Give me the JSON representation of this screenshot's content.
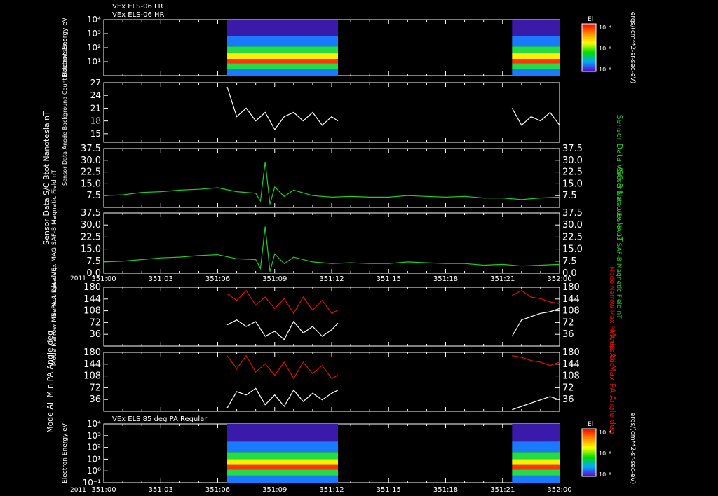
{
  "header": {
    "line1": "VEx ELS-06 LR",
    "line2": "VEx ELS-06 HR",
    "panel7_title": "VEx ELS 85 deg PA Regular"
  },
  "colors": {
    "background": "#000000",
    "axis": "#ffffff",
    "mag_trace": "#22cc22",
    "max_pa": "#dd1111",
    "min_pa": "#ffffff",
    "right_label_green": "#22cc22",
    "right_label_red": "#dd1111"
  },
  "colorbar": {
    "title": "El",
    "ticks": [
      "10⁻⁴",
      "10⁻⁶",
      "10⁻⁸"
    ],
    "units": "ergs/(cm**2-sr-sec-eV)"
  },
  "time_axis": {
    "year": "2011",
    "ticks": [
      "351:00",
      "351:03",
      "351:06",
      "351:09",
      "351:12",
      "351:15",
      "351:18",
      "351:21",
      "352:00"
    ]
  },
  "chart_data": [
    {
      "type": "heatmap",
      "title": "VEx ELS-06 HR",
      "ylabel": "Electron Energy eV",
      "yscale": "log",
      "ylim": [
        1,
        10000
      ],
      "yticks": [
        "10⁴",
        "10³",
        "10²",
        "10¹"
      ],
      "data_intervals": [
        [
          "351:06:30",
          "351:12:20"
        ],
        [
          "351:21:30",
          "352:00"
        ]
      ],
      "colorbar_label": "El"
    },
    {
      "type": "line",
      "ylabel": "Sensor Data Anode Background Count Rate cnts/sec",
      "ylim": [
        13,
        27
      ],
      "yticks": [
        27,
        24,
        21,
        18,
        15
      ],
      "series": [
        {
          "x": [
            "351:06:30",
            "351:07",
            "351:07:30",
            "351:08",
            "351:08:30",
            "351:09",
            "351:09:30",
            "351:10",
            "351:10:30",
            "351:11",
            "351:11:30",
            "351:12",
            "351:12:20"
          ],
          "values": [
            26,
            19,
            21,
            18,
            20,
            16,
            19,
            20,
            18,
            20,
            17,
            19,
            18
          ]
        },
        {
          "x": [
            "351:21:30",
            "351:22",
            "351:22:30",
            "351:23",
            "351:23:30",
            "352:00"
          ],
          "values": [
            21,
            17,
            19,
            18,
            20,
            17
          ]
        }
      ]
    },
    {
      "type": "line",
      "ylabel": "Sensor Data S/C Btot Nanotesla nT",
      "ylabel_right": "Sensor Data VSO B Nanotesla nT",
      "ylim": [
        0,
        37.5
      ],
      "yticks": [
        "37.5",
        "30.0",
        "22.5",
        "15.0",
        "7.5"
      ],
      "series": [
        {
          "x": [
            "351:00",
            "351:01",
            "351:02",
            "351:03",
            "351:04",
            "351:05",
            "351:06",
            "351:07",
            "351:08",
            "351:08:15",
            "351:08:30",
            "351:08:45",
            "351:09",
            "351:09:15",
            "351:09:30",
            "351:10",
            "351:11",
            "351:12",
            "351:13",
            "351:14",
            "351:15",
            "351:16",
            "351:17",
            "351:18",
            "351:19",
            "351:20",
            "351:21",
            "351:22",
            "351:23",
            "352:00"
          ],
          "values": [
            7.5,
            8,
            9.5,
            10,
            11,
            11.5,
            12.5,
            10,
            9,
            4,
            29,
            2,
            13,
            10,
            7,
            11,
            7.5,
            6.5,
            7,
            6.5,
            6.5,
            7.5,
            7,
            6.5,
            7,
            6,
            6,
            5,
            6,
            6.5
          ]
        }
      ]
    },
    {
      "type": "line",
      "ylabel": "Sensor Data VEx MAG SAF-B Magnetic Field nT",
      "ylabel_right": "Sensor Data VEx MAG3 SAF-B Magnetic Field nT",
      "ylim": [
        0,
        37.5
      ],
      "yticks": [
        "37.5",
        "30.0",
        "22.5",
        "15.0",
        "7.5",
        "0.0"
      ],
      "series": [
        {
          "x": [
            "351:00",
            "351:01",
            "351:02",
            "351:03",
            "351:04",
            "351:05",
            "351:06",
            "351:07",
            "351:08",
            "351:08:15",
            "351:08:30",
            "351:08:45",
            "351:09",
            "351:09:15",
            "351:09:30",
            "351:10",
            "351:11",
            "351:12",
            "351:13",
            "351:14",
            "351:15",
            "351:16",
            "351:17",
            "351:18",
            "351:19",
            "351:20",
            "351:21",
            "351:22",
            "351:23",
            "352:00"
          ],
          "values": [
            7,
            7.5,
            8.5,
            9.5,
            10,
            11,
            11.5,
            9,
            8.5,
            3,
            29,
            1,
            12,
            9,
            6,
            10,
            7,
            6,
            6.5,
            6,
            6,
            7,
            6.5,
            6,
            6,
            5,
            5.5,
            4.5,
            5,
            5.5
          ]
        }
      ]
    },
    {
      "type": "line",
      "ylabel": "Mode Narrow Min PA Angle deg",
      "ylabel_right": "Mode Narrow Max PA Angle deg",
      "ylim": [
        0,
        180
      ],
      "yticks": [
        180,
        144,
        108,
        72,
        36
      ],
      "series": [
        {
          "name": "max",
          "x": [
            "351:06:30",
            "351:07",
            "351:07:30",
            "351:08",
            "351:08:30",
            "351:09",
            "351:09:30",
            "351:10",
            "351:10:30",
            "351:11",
            "351:11:30",
            "351:12",
            "351:12:20"
          ],
          "values": [
            160,
            140,
            170,
            125,
            150,
            115,
            145,
            100,
            150,
            110,
            140,
            100,
            110
          ]
        },
        {
          "name": "min",
          "x": [
            "351:06:30",
            "351:07",
            "351:07:30",
            "351:08",
            "351:08:30",
            "351:09",
            "351:09:30",
            "351:10",
            "351:10:30",
            "351:11",
            "351:11:30",
            "351:12",
            "351:12:20"
          ],
          "values": [
            65,
            80,
            60,
            75,
            30,
            45,
            20,
            75,
            40,
            60,
            30,
            50,
            70
          ]
        },
        {
          "name": "max",
          "x": [
            "351:21:30",
            "351:22",
            "351:22:30",
            "351:23",
            "351:23:30",
            "352:00"
          ],
          "values": [
            155,
            170,
            150,
            145,
            135,
            130
          ]
        },
        {
          "name": "min",
          "x": [
            "351:21:30",
            "351:22",
            "351:22:30",
            "351:23",
            "351:23:30",
            "352:00"
          ],
          "values": [
            30,
            80,
            90,
            100,
            105,
            115
          ]
        }
      ]
    },
    {
      "type": "line",
      "ylabel": "Mode All Min PA Angle deg",
      "ylabel_right": "Mode All Max PA Angle deg",
      "ylim": [
        0,
        180
      ],
      "yticks": [
        180,
        144,
        108,
        72,
        36
      ],
      "series": [
        {
          "name": "max",
          "x": [
            "351:06:30",
            "351:07",
            "351:07:30",
            "351:08",
            "351:08:30",
            "351:09",
            "351:09:30",
            "351:10",
            "351:10:30",
            "351:11",
            "351:11:30",
            "351:12",
            "351:12:20"
          ],
          "values": [
            170,
            130,
            170,
            120,
            145,
            110,
            150,
            100,
            150,
            115,
            140,
            100,
            110
          ]
        },
        {
          "name": "min",
          "x": [
            "351:06:30",
            "351:07",
            "351:07:30",
            "351:08",
            "351:08:30",
            "351:09",
            "351:09:30",
            "351:10",
            "351:10:30",
            "351:11",
            "351:11:30",
            "351:12",
            "351:12:20"
          ],
          "values": [
            10,
            60,
            50,
            70,
            20,
            50,
            15,
            65,
            30,
            55,
            35,
            55,
            65
          ]
        },
        {
          "name": "max",
          "x": [
            "351:21:30",
            "351:22",
            "351:22:30",
            "351:23",
            "351:23:30",
            "352:00"
          ],
          "values": [
            170,
            165,
            155,
            150,
            140,
            150
          ]
        },
        {
          "name": "min",
          "x": [
            "351:21:30",
            "351:22",
            "351:22:30",
            "351:23",
            "351:23:30",
            "352:00"
          ],
          "values": [
            5,
            15,
            25,
            35,
            45,
            35
          ]
        }
      ]
    },
    {
      "type": "heatmap",
      "title": "VEx ELS 85 deg PA Regular",
      "ylabel": "Electron Energy eV",
      "yscale": "log",
      "ylim": [
        0.1,
        10000
      ],
      "yticks": [
        "10⁴",
        "10³",
        "10²",
        "10¹",
        "10⁰",
        "10⁻¹"
      ],
      "data_intervals": [
        [
          "351:06:30",
          "351:12:20"
        ],
        [
          "351:21:30",
          "352:00"
        ]
      ],
      "colorbar_label": "El"
    }
  ]
}
